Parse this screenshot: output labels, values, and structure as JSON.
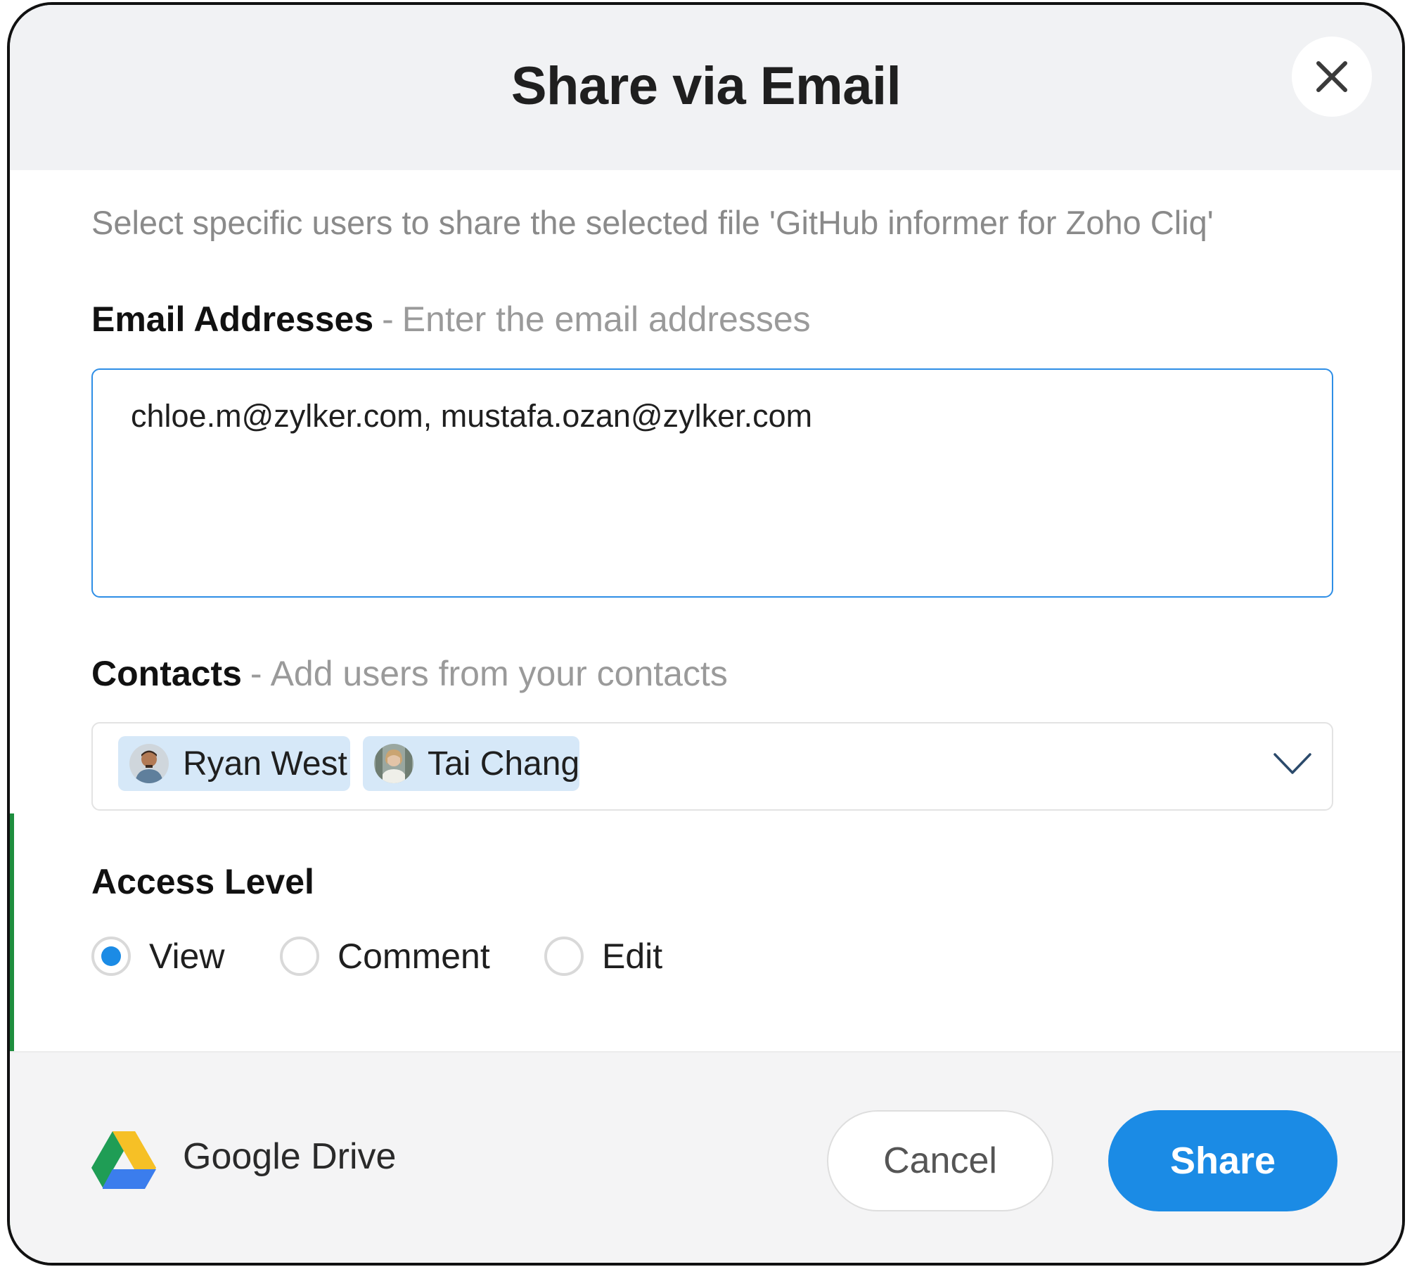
{
  "dialog": {
    "title": "Share via Email",
    "description": "Select specific users to share the selected file 'GitHub informer for Zoho Cliq'"
  },
  "email_section": {
    "label": "Email Addresses",
    "separator": "-",
    "hint": "Enter the email addresses",
    "value": "chloe.m@zylker.com, mustafa.ozan@zylker.com"
  },
  "contacts_section": {
    "label": "Contacts",
    "separator": "-",
    "hint": "Add users from your contacts",
    "chips": [
      {
        "name": "Ryan West",
        "avatar": "person-avatar"
      },
      {
        "name": "Tai Chang",
        "avatar": "person-avatar"
      }
    ],
    "dropdown_icon": "chevron-down-icon"
  },
  "access_section": {
    "label": "Access Level",
    "options": [
      {
        "label": "View",
        "checked": true
      },
      {
        "label": "Comment",
        "checked": false
      },
      {
        "label": "Edit",
        "checked": false
      }
    ]
  },
  "footer": {
    "source_label": "Google Drive",
    "source_icon": "google-drive-icon",
    "cancel_label": "Cancel",
    "share_label": "Share"
  },
  "colors": {
    "accent": "#1b8be5",
    "header_bg": "#f1f2f4",
    "chip_bg": "#d6e8f8",
    "hint_text": "#9a9a9a"
  }
}
